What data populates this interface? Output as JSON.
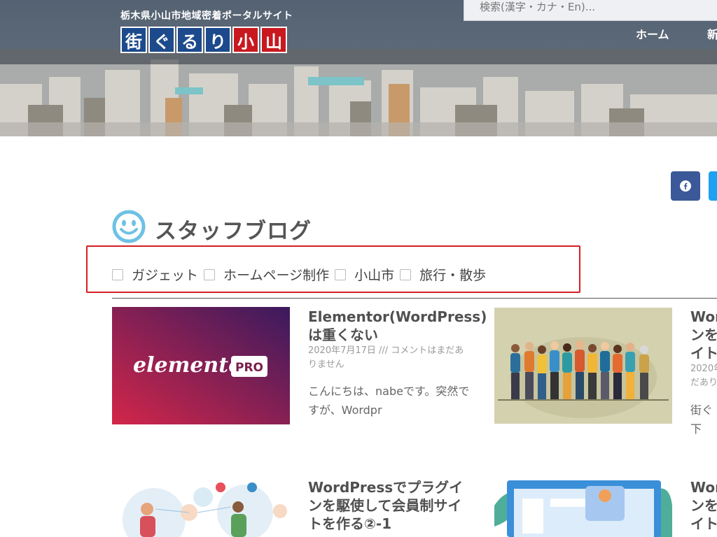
{
  "header": {
    "tagline": "栃木県小山市地域密着ポータルサイト",
    "logo_chars": [
      "街",
      "ぐ",
      "る",
      "り",
      "小",
      "山"
    ],
    "search_placeholder": "検索(漢字・カナ・En)...",
    "nav": [
      {
        "label": "ホーム"
      },
      {
        "label": "新"
      }
    ]
  },
  "section": {
    "title": "スタッフブログ"
  },
  "filters": [
    {
      "label": "ガジェット",
      "checked": false
    },
    {
      "label": "ホームページ制作",
      "checked": false
    },
    {
      "label": "小山市",
      "checked": false
    },
    {
      "label": "旅行・散歩",
      "checked": false
    }
  ],
  "posts": [
    {
      "title": "Elementor(WordPress)は重くない",
      "meta": "2020年7月17日 /// コメントはまだありません",
      "excerpt": "こんにちは、nabeです。突然ですが、Wordpr",
      "thumb_text": "elementor",
      "thumb_badge": "PRO"
    },
    {
      "title": "Wor ンを イト",
      "meta": "2020年 だあり",
      "excerpt": "街ぐ 以下"
    },
    {
      "title": "WordPressでプラグインを駆使して会員制サイトを作る②-1"
    },
    {
      "title": "Wor ンを イト"
    }
  ],
  "colors": {
    "highlight_border": "#d61f24",
    "facebook": "#3b5998",
    "twitter": "#1da1f2",
    "elementor_start": "#d32649",
    "elementor_end": "#3a1a5e",
    "logo_blue": "#1c4a8c",
    "logo_red": "#c8191f",
    "smiley": "#6ec1e4"
  },
  "icons": {
    "share_facebook": "facebook-icon",
    "share_twitter": "twitter-icon",
    "section": "smiley-icon"
  }
}
